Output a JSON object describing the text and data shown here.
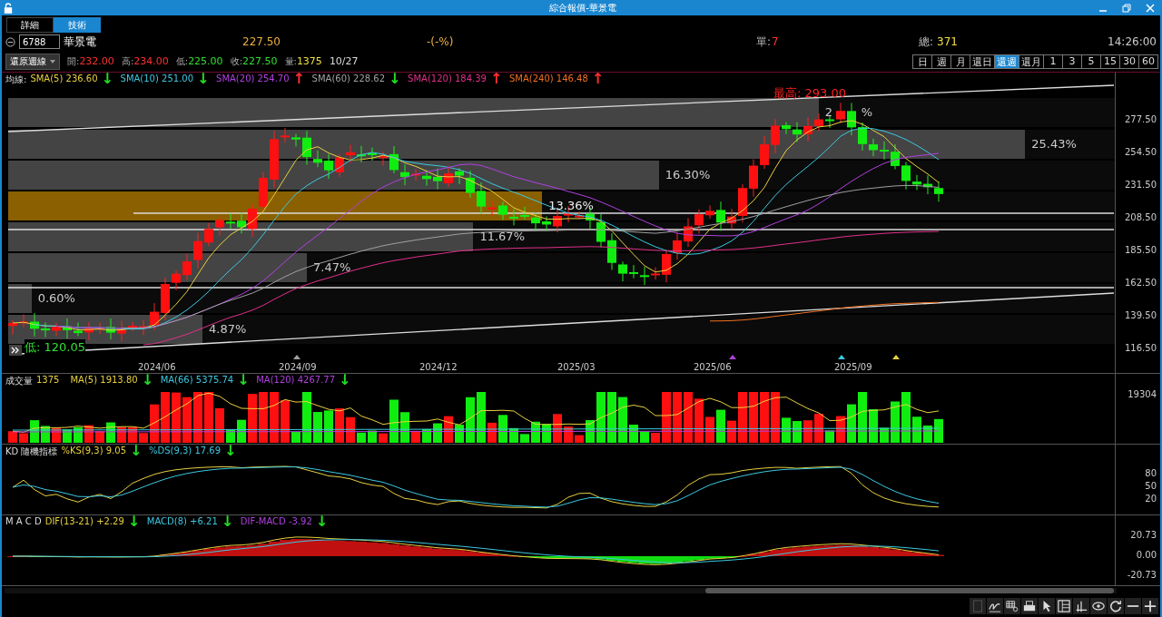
{
  "window": {
    "title": "綜合報價-華景電"
  },
  "tabs": [
    {
      "label": "詳細",
      "selected": false
    },
    {
      "label": "技術",
      "selected": true
    }
  ],
  "quote": {
    "symbol": "6788",
    "name": "華景電",
    "price": "227.50",
    "change": "-(-%)",
    "single_label": "單:",
    "single": "7",
    "total_label": "總:",
    "total": "371",
    "time": "14:26:00"
  },
  "ohlc": {
    "mode": "還原週線",
    "date": "10/27",
    "fields": [
      {
        "label": "開:",
        "value": "232.00",
        "color": "#ff3030"
      },
      {
        "label": "高:",
        "value": "234.00",
        "color": "#ff3030"
      },
      {
        "label": "低:",
        "value": "225.00",
        "color": "#30e030"
      },
      {
        "label": "收:",
        "value": "227.50",
        "color": "#30e030"
      },
      {
        "label": "量:",
        "value": "1375",
        "color": "#f0e040"
      }
    ]
  },
  "periods": [
    {
      "label": "日",
      "selected": false
    },
    {
      "label": "週",
      "selected": false
    },
    {
      "label": "月",
      "selected": false
    },
    {
      "label": "還日",
      "selected": false
    },
    {
      "label": "還週",
      "selected": true
    },
    {
      "label": "還月",
      "selected": false
    },
    {
      "label": "1",
      "selected": false
    },
    {
      "label": "3",
      "selected": false
    },
    {
      "label": "5",
      "selected": false
    },
    {
      "label": "15",
      "selected": false
    },
    {
      "label": "30",
      "selected": false
    },
    {
      "label": "60",
      "selected": false
    }
  ],
  "main_chart": {
    "legend_title": "均線:",
    "indicators": [
      {
        "name": "SMA(5) 236.60",
        "arrow": {
          "label": "↓",
          "color": "#20e020"
        },
        "color": "#e8d040"
      },
      {
        "name": "SMA(10) 251.00",
        "arrow": {
          "label": "↓",
          "color": "#20e020"
        },
        "color": "#3cc8e0"
      },
      {
        "name": "SMA(20) 254.70",
        "arrow": {
          "label": "↑",
          "color": "#ff3030"
        },
        "color": "#b040e0"
      },
      {
        "name": "SMA(60) 228.62",
        "arrow": {
          "label": "↓",
          "color": "#20e020"
        },
        "color": "#a0a0a0"
      },
      {
        "name": "SMA(120) 184.39",
        "arrow": {
          "label": "↑",
          "color": "#ff3030"
        },
        "color": "#e0308a"
      },
      {
        "name": "SMA(240) 146.48",
        "arrow": {
          "label": "↑",
          "color": "#ff3030"
        },
        "color": "#f07020"
      }
    ],
    "high_label": "最高: 293.00",
    "low_label": "低: 120.05",
    "profile": [
      {
        "label": "2",
        "label_end": "%",
        "level": 0.73,
        "highlight": false
      },
      {
        "label": "25.43%",
        "level": 0.916,
        "highlight": false
      },
      {
        "label": "16.30%",
        "level": 0.586,
        "highlight": false
      },
      {
        "label": "13.36%",
        "level": 0.481,
        "highlight": true
      },
      {
        "label": "11.67%",
        "level": 0.419,
        "highlight": false
      },
      {
        "label": "7.47%",
        "level": 0.269,
        "highlight": false
      },
      {
        "label": "0.60%",
        "level": 0.021,
        "highlight": false
      },
      {
        "label": "4.87%",
        "level": 0.175,
        "highlight": false
      }
    ],
    "yticks": [
      "277.50",
      "254.50",
      "231.50",
      "208.50",
      "185.50",
      "162.50",
      "139.50",
      "116.50"
    ],
    "xlabels": [
      "2024/06",
      "2024/09",
      "2024/12",
      "2025/03",
      "2025/06",
      "2025/09"
    ]
  },
  "volume": {
    "title": "成交量",
    "value": "1375",
    "indicators": [
      {
        "name": "MA(5) 1913.80",
        "arrow": {
          "label": "↓",
          "color": "#20e020"
        },
        "color": "#e8d040"
      },
      {
        "name": "MA(66) 5375.74",
        "arrow": {
          "label": "↓",
          "color": "#20e020"
        },
        "color": "#3cc8e0"
      },
      {
        "name": "MA(120) 4267.77",
        "arrow": {
          "label": "↓",
          "color": "#20e020"
        },
        "color": "#b040e0"
      }
    ],
    "yticks": [
      "19304"
    ]
  },
  "kd": {
    "title": "KD 隨機指標",
    "indicators": [
      {
        "name": "%KS(9,3) 9.05",
        "arrow": {
          "label": "↓",
          "color": "#20e020"
        },
        "color": "#e8d040"
      },
      {
        "name": "%DS(9,3) 17.69",
        "arrow": {
          "label": "↓",
          "color": "#20e020"
        },
        "color": "#3cc8e0"
      }
    ],
    "yticks": [
      "80",
      "50",
      "20"
    ]
  },
  "macd": {
    "title": "M A C D",
    "indicators": [
      {
        "name": "DIF(13-21)  +2.29",
        "arrow": {
          "label": "↓",
          "color": "#20e020"
        },
        "color": "#e8d040"
      },
      {
        "name": "MACD(8)  +6.21",
        "arrow": {
          "label": "↓",
          "color": "#20e020"
        },
        "color": "#3cc8e0"
      },
      {
        "name": "DIF-MACD  -3.92",
        "arrow": {
          "label": "↓",
          "color": "#20e020"
        },
        "color": "#b040e0"
      }
    ],
    "yticks": [
      "20.73",
      "0.00",
      "-20.73"
    ]
  }
}
